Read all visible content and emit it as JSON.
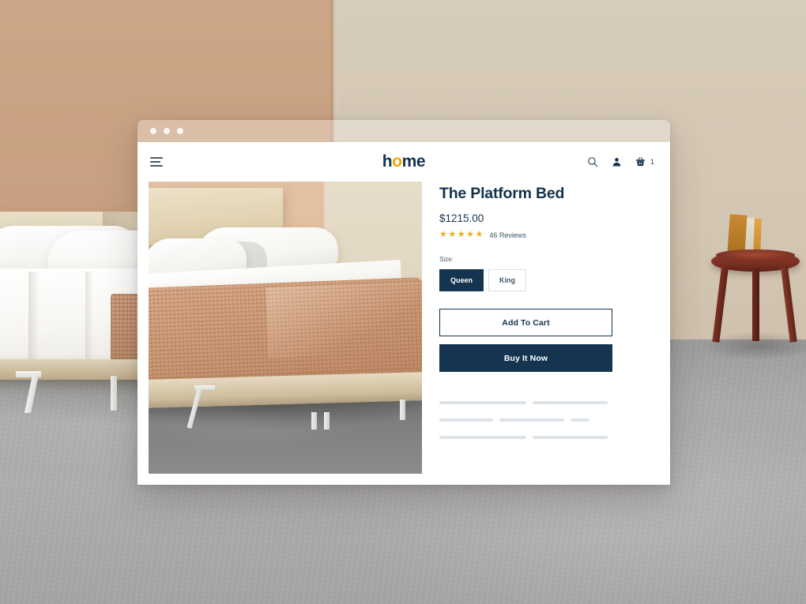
{
  "window": {
    "dots": [
      "dot-1",
      "dot-2",
      "dot-3"
    ]
  },
  "header": {
    "menu_icon": "hamburger-menu-icon",
    "brand_prefix": "h",
    "brand_accent": "o",
    "brand_suffix": "me",
    "search_icon": "search-icon",
    "account_icon": "user-account-icon",
    "cart_icon": "shopping-basket-icon",
    "cart_count": "1"
  },
  "product": {
    "image_alt": "platform-bed-photo",
    "title": "The Platform Bed",
    "price": "$1215.00",
    "stars": [
      "★",
      "★",
      "★",
      "★",
      "★"
    ],
    "star_count": 5,
    "reviews": "46 Reviews",
    "size_label": "Size:",
    "sizes": [
      {
        "label": "Queen",
        "selected": true
      },
      {
        "label": "King",
        "selected": false
      }
    ],
    "add_to_cart": "Add To Cart",
    "buy_it_now": "Buy It Now"
  },
  "skeleton": {
    "rows": [
      [
        110,
        95
      ],
      [
        68,
        82,
        24
      ],
      [
        110,
        95
      ]
    ]
  },
  "colors": {
    "brand_navy": "#14344F",
    "brand_accent": "#F0A500",
    "star_gold": "#F0AD1E",
    "skeleton_gray": "#DDE3E8",
    "page_bg": "#FFFFFF"
  }
}
